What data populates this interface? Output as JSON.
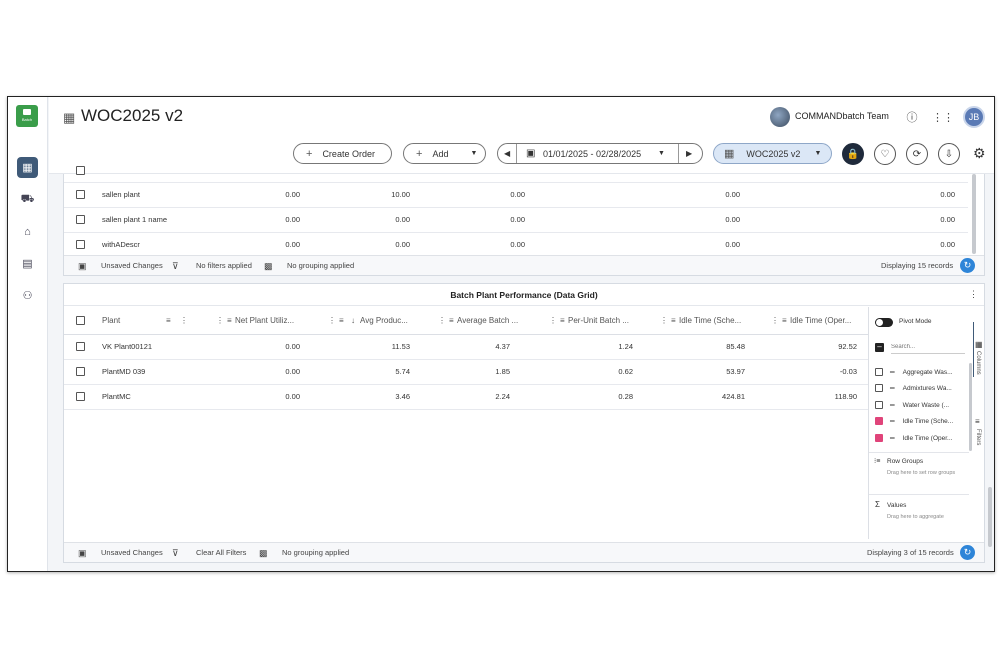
{
  "app": {
    "title": "WOC2025 v2",
    "logo_text": "Batch",
    "team_name": "COMMANDbatch Team",
    "user_initials": "JB"
  },
  "toolbar": {
    "create_order": "Create Order",
    "add": "Add",
    "date_range": "01/01/2025 - 02/28/2025",
    "woc_select": "WOC2025 v2"
  },
  "top_grid": {
    "rows": [
      {
        "plant": "sallen plant",
        "c1": "0.00",
        "c2": "10.00",
        "c3": "0.00",
        "c4": "0.00",
        "c5": "0.00"
      },
      {
        "plant": "sallen plant 1 name",
        "c1": "0.00",
        "c2": "0.00",
        "c3": "0.00",
        "c4": "0.00",
        "c5": "0.00"
      },
      {
        "plant": "withADescr",
        "c1": "0.00",
        "c2": "0.00",
        "c3": "0.00",
        "c4": "0.00",
        "c5": "0.00"
      }
    ],
    "footer": {
      "unsaved": "Unsaved Changes",
      "filters": "No filters applied",
      "grouping": "No grouping applied",
      "records": "Displaying 15 records"
    }
  },
  "bottom_grid": {
    "title": "Batch Plant Performance (Data Grid)",
    "columns": [
      "Plant",
      "Net Plant Utiliz...",
      "Avg Produc...",
      "Average Batch ...",
      "Per-Unit Batch ...",
      "Idle Time (Sche...",
      "Idle Time (Oper..."
    ],
    "rows": [
      {
        "plant": "VK Plant00121",
        "c1": "0.00",
        "c2": "11.53",
        "c3": "4.37",
        "c4": "1.24",
        "c5": "85.48",
        "c6": "92.52"
      },
      {
        "plant": "PlantMD 039",
        "c1": "0.00",
        "c2": "5.74",
        "c3": "1.85",
        "c4": "0.62",
        "c5": "53.97",
        "c6": "-0.03"
      },
      {
        "plant": "PlantMC",
        "c1": "0.00",
        "c2": "3.46",
        "c3": "2.24",
        "c4": "0.28",
        "c5": "424.81",
        "c6": "118.90"
      }
    ],
    "footer": {
      "unsaved": "Unsaved Changes",
      "filters": "Clear All Filters",
      "grouping": "No grouping applied",
      "records": "Displaying 3 of 15 records"
    }
  },
  "side_panel": {
    "pivot_mode": "Pivot Mode",
    "search_placeholder": "Search...",
    "columns": [
      {
        "label": "Aggregate Was...",
        "checked": false
      },
      {
        "label": "Admixtures Wa...",
        "checked": false
      },
      {
        "label": "Water Waste (...",
        "checked": false
      },
      {
        "label": "Idle Time (Sche...",
        "checked": true
      },
      {
        "label": "Idle Time (Oper...",
        "checked": true
      }
    ],
    "row_groups_title": "Row Groups",
    "row_groups_hint": "Drag here to set row groups",
    "values_title": "Values",
    "values_hint": "Drag here to aggregate",
    "tab_columns": "Columns",
    "tab_filters": "Filters"
  },
  "colors": {
    "accent": "#2e85d8",
    "checkbox_on": "#e0447a",
    "rail_active": "#3f5a78"
  }
}
